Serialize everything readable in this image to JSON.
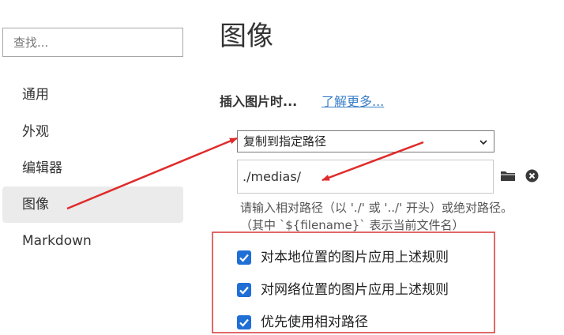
{
  "sidebar": {
    "search_placeholder": "查找...",
    "items": [
      {
        "label": "通用"
      },
      {
        "label": "外观"
      },
      {
        "label": "编辑器"
      },
      {
        "label": "图像"
      },
      {
        "label": "Markdown"
      }
    ]
  },
  "main": {
    "title": "图像",
    "insert_label": "插入图片时...",
    "learn_more": "了解更多...",
    "select_value": "复制到指定路径",
    "path_value": "./medias/",
    "hint_text": "请输入相对路径（以 './' 或 '../' 开头）或绝对路径。（其中 `${filename}` 表示当前文件名）",
    "rules": [
      {
        "label": "对本地位置的图片应用上述规则",
        "checked": true
      },
      {
        "label": "对网络位置的图片应用上述规则",
        "checked": true
      },
      {
        "label": "优先使用相对路径",
        "checked": true
      }
    ]
  },
  "colors": {
    "accent": "#1f6fd6",
    "link": "#3a7ec6",
    "annotation": "#e02b2b",
    "active_nav": "#ebebeb"
  },
  "icons": [
    "chevron-down-icon",
    "folder-icon",
    "clear-icon",
    "checkmark-icon"
  ]
}
